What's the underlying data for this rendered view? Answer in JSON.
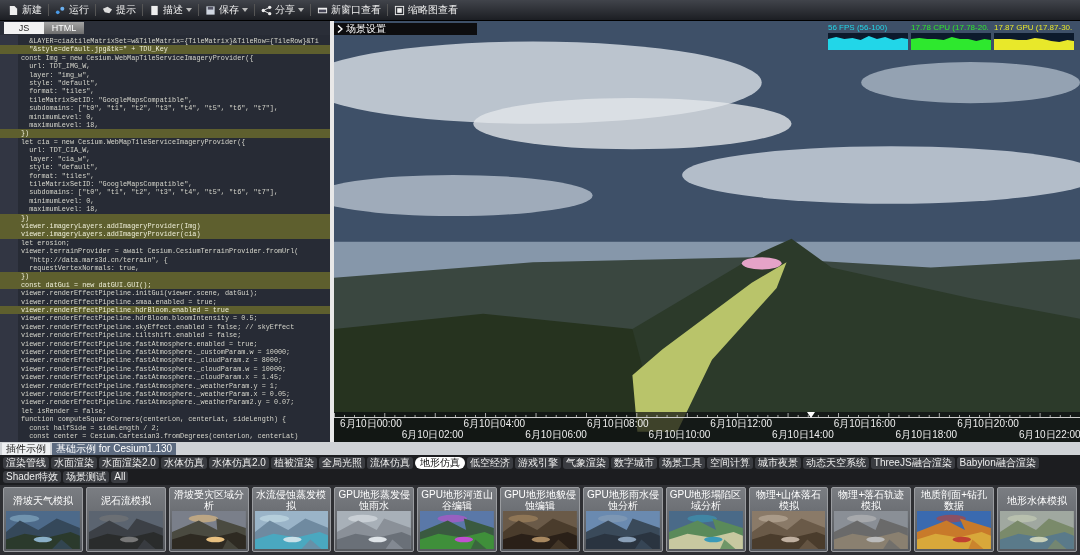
{
  "toolbar": [
    {
      "label": "新建",
      "dropdown": false
    },
    {
      "label": "运行",
      "dropdown": false
    },
    {
      "label": "提示",
      "dropdown": false
    },
    {
      "label": "描述",
      "dropdown": true
    },
    {
      "label": "保存",
      "dropdown": true
    },
    {
      "label": "分享",
      "dropdown": true
    },
    {
      "label": "新窗口查看",
      "dropdown": false
    },
    {
      "label": "缩略图查看",
      "dropdown": false
    }
  ],
  "editor": {
    "tabs": [
      {
        "label": "JS",
        "selected": true
      },
      {
        "label": "HTML",
        "selected": false
      }
    ],
    "lines": [
      {
        "text": "  &LAYER=cia&tileMatrixSet=w&TileMatrix={TileMatrix}&TileRow={TileRow}&Ti",
        "highlighted": false
      },
      {
        "text": "  \"&style=default.jpg&tk=\" + TDU_Key",
        "highlighted": true
      },
      {
        "text": "const Img = new Cesium.WebMapTileServiceImageryProvider({",
        "highlighted": false
      },
      {
        "text": "  url: TDT_IMG_W,",
        "highlighted": false
      },
      {
        "text": "  layer: \"img_w\",",
        "highlighted": false
      },
      {
        "text": "  style: \"default\",",
        "highlighted": false
      },
      {
        "text": "  format: \"tiles\",",
        "highlighted": false
      },
      {
        "text": "  tileMatrixSetID: \"GoogleMapsCompatible\",",
        "highlighted": false
      },
      {
        "text": "  subdomains: [\"t0\", \"t1\", \"t2\", \"t3\", \"t4\", \"t5\", \"t6\", \"t7\"],",
        "highlighted": false
      },
      {
        "text": "  minimumLevel: 0,",
        "highlighted": false
      },
      {
        "text": "  maximumLevel: 18,",
        "highlighted": false
      },
      {
        "text": "})",
        "highlighted": true
      },
      {
        "text": "let cia = new Cesium.WebMapTileServiceImageryProvider({",
        "highlighted": false
      },
      {
        "text": "  url: TDT_CIA_W,",
        "highlighted": false
      },
      {
        "text": "  layer: \"cia_w\",",
        "highlighted": false
      },
      {
        "text": "  style: \"default\",",
        "highlighted": false
      },
      {
        "text": "  format: \"tiles\",",
        "highlighted": false
      },
      {
        "text": "  tileMatrixSetID: \"GoogleMapsCompatible\",",
        "highlighted": false
      },
      {
        "text": "  subdomains: [\"t0\", \"t1\", \"t2\", \"t3\", \"t4\", \"t5\", \"t6\", \"t7\"],",
        "highlighted": false
      },
      {
        "text": "  minimumLevel: 0,",
        "highlighted": false
      },
      {
        "text": "  maximumLevel: 18,",
        "highlighted": false
      },
      {
        "text": "})",
        "highlighted": true
      },
      {
        "text": "viewer.imageryLayers.addImageryProvider(Img)",
        "highlighted": true
      },
      {
        "text": "viewer.imageryLayers.addImageryProvider(cia)",
        "highlighted": true
      },
      {
        "text": "let erosion;",
        "highlighted": false
      },
      {
        "text": "viewer.terrainProvider = await Cesium.CesiumTerrainProvider.fromUrl(",
        "highlighted": false
      },
      {
        "text": "  \"http://data.mars3d.cn/terrain\", {",
        "highlighted": false
      },
      {
        "text": "  requestVertexNormals: true,",
        "highlighted": false
      },
      {
        "text": "})",
        "highlighted": true
      },
      {
        "text": "const datGui = new datGUI.GUI();",
        "highlighted": true
      },
      {
        "text": "viewer.renderEffectPipeline.initGui(viewer.scene, datGui);",
        "highlighted": false
      },
      {
        "text": "viewer.renderEffectPipeline.smaa.enabled = true;",
        "highlighted": false
      },
      {
        "text": "viewer.renderEffectPipeline.hdrBloom.enabled = true",
        "highlighted": true
      },
      {
        "text": "viewer.renderEffectPipeline.hdrBloom.bloomIntensity = 0.5;",
        "highlighted": false
      },
      {
        "text": "viewer.renderEffectPipeline.skyEffect.enabled = false; // skyEffect",
        "highlighted": false
      },
      {
        "text": "viewer.renderEffectPipeline.tiltshift.enabled = false;",
        "highlighted": false
      },
      {
        "text": "viewer.renderEffectPipeline.fastAtmosphere.enabled = true;",
        "highlighted": false
      },
      {
        "text": "viewer.renderEffectPipeline.fastAtmosphere._customParam.w = 10000;",
        "highlighted": false
      },
      {
        "text": "viewer.renderEffectPipeline.fastAtmosphere._cloudParam.z = 8000;",
        "highlighted": false
      },
      {
        "text": "viewer.renderEffectPipeline.fastAtmosphere._cloudParam.w = 10000;",
        "highlighted": false
      },
      {
        "text": "viewer.renderEffectPipeline.fastAtmosphere._cloudParam.x = 1.45;",
        "highlighted": false
      },
      {
        "text": "viewer.renderEffectPipeline.fastAtmosphere._weatherParam.y = 1;",
        "highlighted": false
      },
      {
        "text": "viewer.renderEffectPipeline.fastAtmosphere._weatherParam.x = 0.05;",
        "highlighted": false
      },
      {
        "text": "viewer.renderEffectPipeline.fastAtmosphere._weatherParam2.y = 0.07;",
        "highlighted": false
      },
      {
        "text": "let isRender = false;",
        "highlighted": false
      },
      {
        "text": "function computeSquareCorners(centerLon, centerLat, sideLength) {",
        "highlighted": false
      },
      {
        "text": "  const halfSide = sideLength / 2;",
        "highlighted": false
      },
      {
        "text": "  const center = Cesium.Cartesian3.fromDegrees(centerLon, centerLat)",
        "highlighted": false
      }
    ]
  },
  "scene": {
    "panel_title": "场景设置",
    "stats": [
      {
        "label": "56 FPS (56-100)",
        "color": "#22d6e8"
      },
      {
        "label": "17.78 CPU (17.78-20.",
        "color": "#2ee82e"
      },
      {
        "label": "17.87 GPU (17.87-30.",
        "color": "#e8e82a"
      }
    ],
    "timeline": {
      "labels": [
        "6月10日00:00",
        "6月10日02:00",
        "6月10日04:00",
        "6月10日06:00",
        "6月10日08:00",
        "6月10日10:00",
        "6月10日12:00",
        "6月10日14:00",
        "6月10日16:00",
        "6月10日18:00",
        "6月10日20:00",
        "6月10日22:00"
      ],
      "level": 0.64
    }
  },
  "example_tabs": [
    {
      "label": "插件示例",
      "selected": true
    },
    {
      "label": "基础示例 for Cesium1.130",
      "selected": false
    }
  ],
  "categories": [
    {
      "label": "渲染管线",
      "selected": false
    },
    {
      "label": "水面渲染",
      "selected": false
    },
    {
      "label": "水面渲染2.0",
      "selected": false
    },
    {
      "label": "水体仿真",
      "selected": false
    },
    {
      "label": "水体仿真2.0",
      "selected": false
    },
    {
      "label": "植被渲染",
      "selected": false
    },
    {
      "label": "全局光照",
      "selected": false
    },
    {
      "label": "流体仿真",
      "selected": false
    },
    {
      "label": "地形仿真",
      "selected": true
    },
    {
      "label": "低空经济",
      "selected": false
    },
    {
      "label": "游戏引擎",
      "selected": false
    },
    {
      "label": "气象渲染",
      "selected": false
    },
    {
      "label": "数字城市",
      "selected": false
    },
    {
      "label": "场景工具",
      "selected": false
    },
    {
      "label": "空间计算",
      "selected": false
    },
    {
      "label": "城市夜景",
      "selected": false
    },
    {
      "label": "动态天空系统",
      "selected": false
    },
    {
      "label": "ThreeJS融合渲染",
      "selected": false
    },
    {
      "label": "Babylon融合渲染",
      "selected": false
    },
    {
      "label": "Shader特效",
      "selected": false
    },
    {
      "label": "场景测试",
      "selected": false
    },
    {
      "label": "All",
      "selected": false
    }
  ],
  "examples": [
    {
      "title": "滑坡天气模拟",
      "kind": "picture"
    },
    {
      "title": "泥石流模拟",
      "kind": "picture"
    },
    {
      "title": "滑坡受灾区域分析",
      "kind": "picture"
    },
    {
      "title": "水流侵蚀蒸发模拟",
      "kind": "picture"
    },
    {
      "title": "GPU地形蒸发侵蚀雨水",
      "kind": "picture"
    },
    {
      "title": "GPU地形河道山谷编辑",
      "kind": "picture"
    },
    {
      "title": "GPU地形地貌侵蚀编辑",
      "kind": "picture"
    },
    {
      "title": "GPU地形雨水侵蚀分析",
      "kind": "picture"
    },
    {
      "title": "GPU地形塌陷区域分析",
      "kind": "picture"
    },
    {
      "title": "物理+山体落石模拟",
      "kind": "picture"
    },
    {
      "title": "物理+落石轨迹模拟",
      "kind": "picture"
    },
    {
      "title": "地质剖面+钻孔数据",
      "kind": "picture"
    },
    {
      "title": "地形水体模拟",
      "kind": "picture"
    }
  ]
}
